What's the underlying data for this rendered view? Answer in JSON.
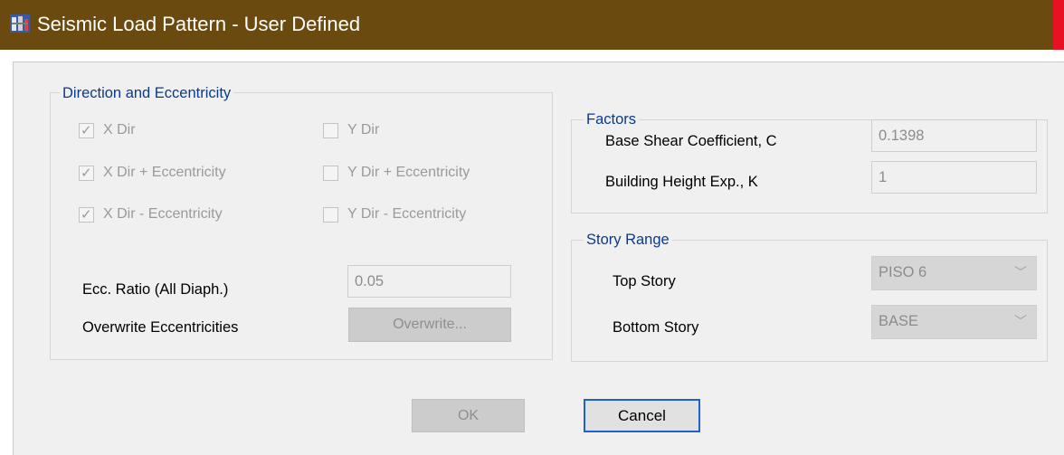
{
  "window": {
    "title": "Seismic Load Pattern - User Defined"
  },
  "direction": {
    "legend": "Direction and Eccentricity",
    "checkboxes": [
      {
        "label": "X Dir",
        "checked": true
      },
      {
        "label": "X Dir + Eccentricity",
        "checked": true
      },
      {
        "label": "X Dir - Eccentricity",
        "checked": true
      },
      {
        "label": "Y Dir",
        "checked": false
      },
      {
        "label": "Y Dir + Eccentricity",
        "checked": false
      },
      {
        "label": "Y Dir - Eccentricity",
        "checked": false
      }
    ],
    "ecc_ratio_label": "Ecc. Ratio (All Diaph.)",
    "ecc_ratio_value": "0.05",
    "overwrite_label": "Overwrite Eccentricities",
    "overwrite_button": "Overwrite..."
  },
  "factors": {
    "legend": "Factors",
    "base_shear_label": "Base Shear Coefficient, C",
    "base_shear_value": "0.1398",
    "height_exp_label": "Building Height Exp., K",
    "height_exp_value": "1"
  },
  "story_range": {
    "legend": "Story Range",
    "top_label": "Top Story",
    "top_value": "PISO 6",
    "bottom_label": "Bottom Story",
    "bottom_value": "BASE"
  },
  "buttons": {
    "ok": "OK",
    "cancel": "Cancel"
  },
  "colors": {
    "titlebar": "#6b4a0f",
    "legend_text": "#0a3a8c",
    "focus_border": "#1f62c9"
  }
}
